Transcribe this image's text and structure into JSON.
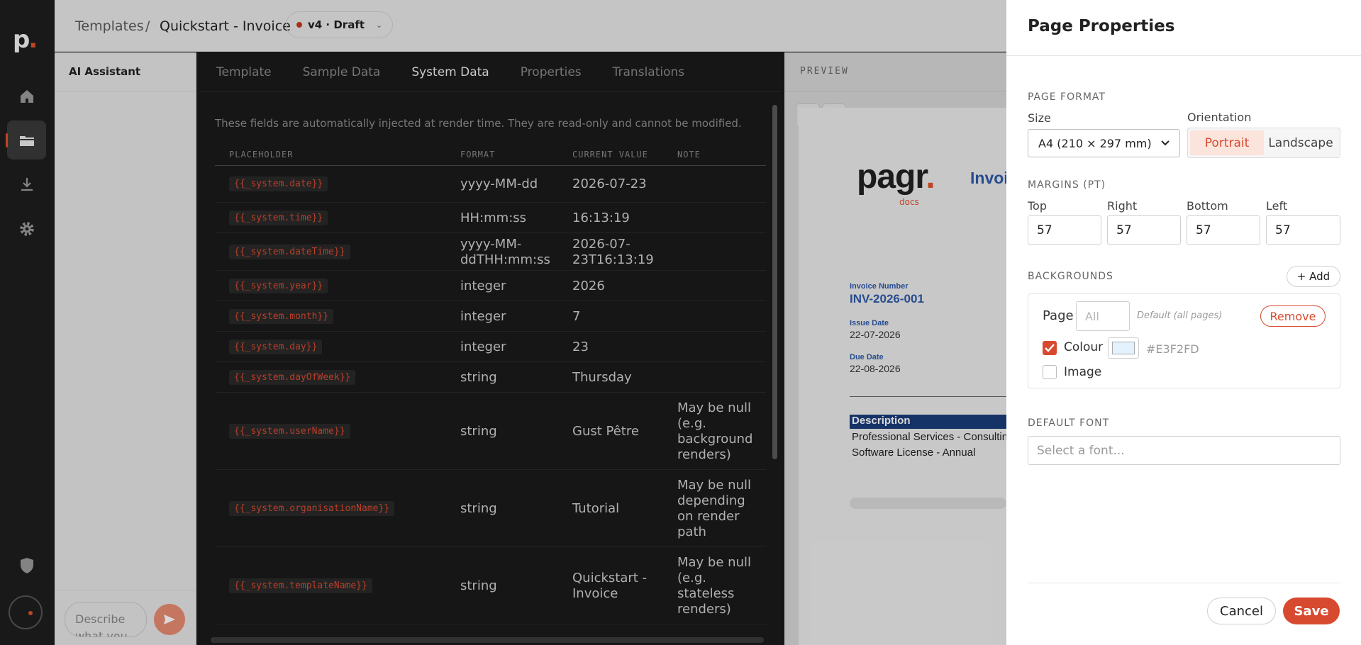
{
  "rail": {
    "logo": "p",
    "logo_dot": ".",
    "items": [
      "home-icon",
      "folder-icon",
      "download-icon",
      "settings-icon",
      "shield-icon",
      "user-icon"
    ]
  },
  "header": {
    "breadcrumb_root": "Templates",
    "separator": "/",
    "current": "Quickstart - Invoice",
    "version": "v4 · Draft"
  },
  "ai": {
    "title": "AI Assistant",
    "prompt_placeholder": "Describe what you"
  },
  "editor": {
    "tabs": [
      "Template",
      "Sample Data",
      "System Data",
      "Properties",
      "Translations"
    ],
    "active_tab": "System Data",
    "hint": "These fields are automatically injected at render time. They are read-only and cannot be modified.",
    "columns": [
      "PLACEHOLDER",
      "FORMAT",
      "CURRENT VALUE",
      "NOTE"
    ],
    "rows": [
      {
        "ph": "{{_system.date}}",
        "fmt": "yyyy-MM-dd",
        "cur": "2026-07-23",
        "note": ""
      },
      {
        "ph": "{{_system.time}}",
        "fmt": "HH:mm:ss",
        "cur": "16:13:19",
        "note": ""
      },
      {
        "ph": "{{_system.dateTime}}",
        "fmt": "yyyy-MM-ddTHH:mm:ss",
        "cur": "2026-07-23T16:13:19",
        "note": ""
      },
      {
        "ph": "{{_system.year}}",
        "fmt": "integer",
        "cur": "2026",
        "note": ""
      },
      {
        "ph": "{{_system.month}}",
        "fmt": "integer",
        "cur": "7",
        "note": ""
      },
      {
        "ph": "{{_system.day}}",
        "fmt": "integer",
        "cur": "23",
        "note": ""
      },
      {
        "ph": "{{_system.dayOfWeek}}",
        "fmt": "string",
        "cur": "Thursday",
        "note": ""
      },
      {
        "ph": "{{_system.userName}}",
        "fmt": "string",
        "cur": "Gust Pêtre",
        "note": "May be null (e.g. background renders)"
      },
      {
        "ph": "{{_system.organisationName}}",
        "fmt": "string",
        "cur": "Tutorial",
        "note": "May be null depending on render path"
      },
      {
        "ph": "{{_system.templateName}}",
        "fmt": "string",
        "cur": "Quickstart - Invoice",
        "note": "May be null (e.g. stateless renders)"
      }
    ]
  },
  "preview": {
    "label": "PREVIEW",
    "logo_main": "pagr",
    "logo_dot": ".",
    "logo_sub": "docs",
    "title": "Invoic",
    "invoice_number_label": "Invoice Number",
    "invoice_number": "INV-2026-001",
    "issue_date_label": "Issue Date",
    "issue_date": "22-07-2026",
    "due_date_label": "Due Date",
    "due_date": "22-08-2026",
    "table_header": "Description",
    "table_rows": [
      "Professional Services - Consultin",
      "Software License - Annual"
    ]
  },
  "sheet": {
    "title": "Page Properties",
    "page_format_label": "PAGE FORMAT",
    "size_label": "Size",
    "size_value": "A4 (210 × 297 mm)",
    "orientation_label": "Orientation",
    "orientation_options": [
      "Portrait",
      "Landscape"
    ],
    "orientation_selected": "Portrait",
    "margins_label": "MARGINS (PT)",
    "margins": {
      "top_label": "Top",
      "right_label": "Right",
      "bottom_label": "Bottom",
      "left_label": "Left",
      "top": "57",
      "right": "57",
      "bottom": "57",
      "left": "57"
    },
    "backgrounds_label": "BACKGROUNDS",
    "add_label": "+ Add",
    "bg": {
      "page_label": "Page",
      "page_placeholder": "All",
      "default_hint": "Default (all pages)",
      "remove_label": "Remove",
      "colour_label": "Colour",
      "colour_checked": true,
      "colour_hex": "#E3F2FD",
      "image_label": "Image",
      "image_checked": false
    },
    "default_font_label": "DEFAULT FONT",
    "font_placeholder": "Select a font...",
    "cancel_label": "Cancel",
    "save_label": "Save"
  }
}
